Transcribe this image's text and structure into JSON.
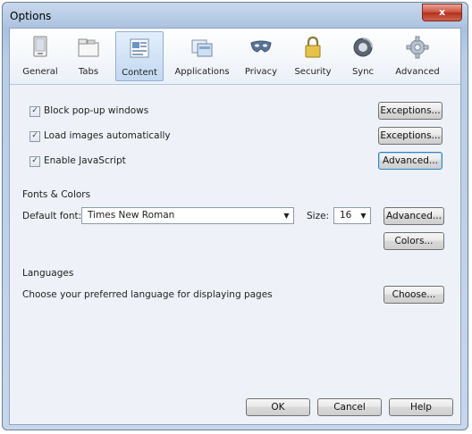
{
  "window": {
    "title": "Options",
    "close_label": "x"
  },
  "tabs": [
    {
      "label": "General",
      "icon": "general-icon",
      "selected": false
    },
    {
      "label": "Tabs",
      "icon": "tabs-icon",
      "selected": false
    },
    {
      "label": "Content",
      "icon": "content-icon",
      "selected": true
    },
    {
      "label": "Applications",
      "icon": "applications-icon",
      "selected": false
    },
    {
      "label": "Privacy",
      "icon": "privacy-mask-icon",
      "selected": false
    },
    {
      "label": "Security",
      "icon": "security-lock-icon",
      "selected": false
    },
    {
      "label": "Sync",
      "icon": "sync-icon",
      "selected": false
    },
    {
      "label": "Advanced",
      "icon": "advanced-gear-icon",
      "selected": false
    }
  ],
  "content": {
    "block_popups": {
      "label": "Block pop-up windows",
      "checked": true,
      "button": "Exceptions..."
    },
    "load_images": {
      "label": "Load images automatically",
      "checked": true,
      "button": "Exceptions..."
    },
    "enable_js": {
      "label": "Enable JavaScript",
      "checked": true,
      "button": "Advanced..."
    }
  },
  "fonts": {
    "section_title": "Fonts & Colors",
    "default_font_label": "Default font:",
    "default_font_value": "Times New Roman",
    "size_label": "Size:",
    "size_value": "16",
    "advanced_button": "Advanced...",
    "colors_button": "Colors..."
  },
  "languages": {
    "section_title": "Languages",
    "description": "Choose your preferred language for displaying pages",
    "choose_button": "Choose..."
  },
  "footer": {
    "ok": "OK",
    "cancel": "Cancel",
    "help": "Help"
  },
  "colors": {
    "title_gradient_top": "#c9d9ec",
    "selected_tab": "#c3d8f1",
    "close_button": "#c9503c"
  }
}
